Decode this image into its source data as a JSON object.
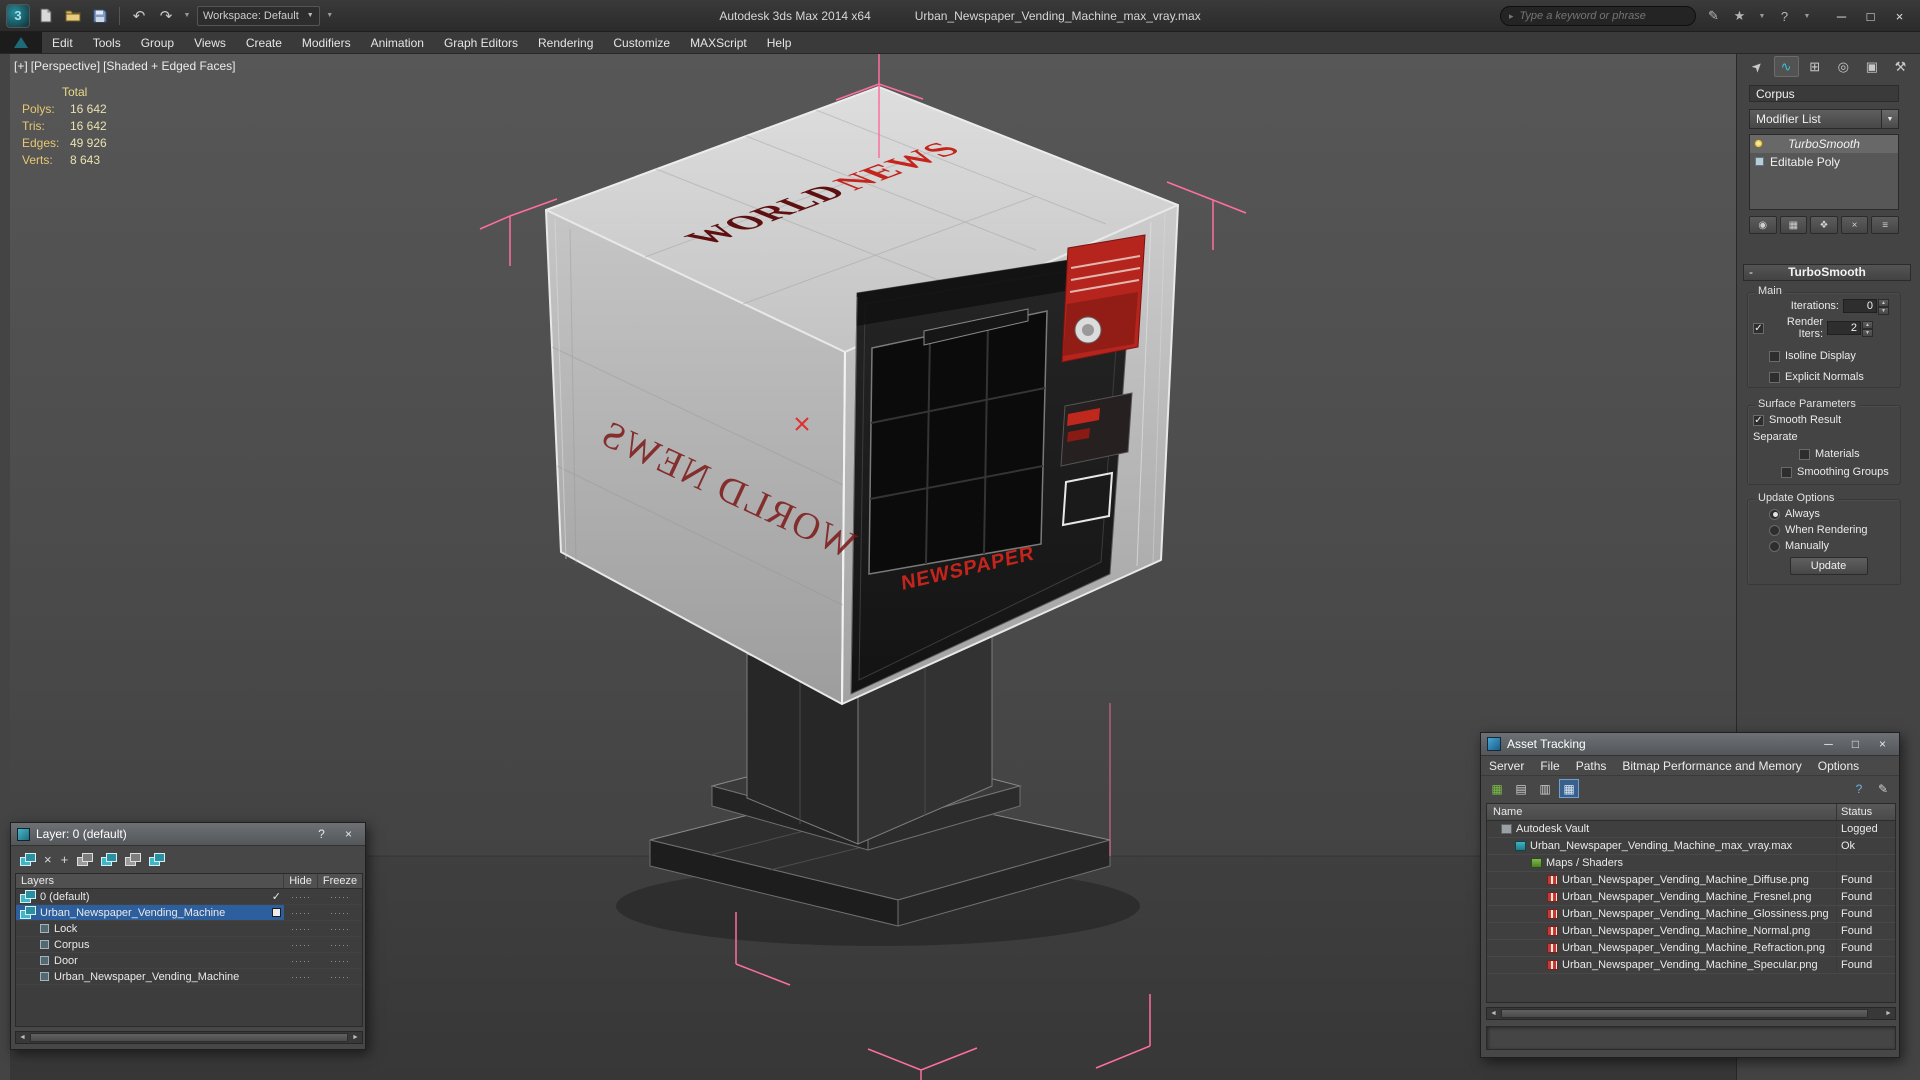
{
  "icons": {
    "dropdown": "▼",
    "check": "✓",
    "close": "×",
    "minimize": "─",
    "maximize": "□",
    "help": "?",
    "search_hint": "▸",
    "scroll_left": "◄",
    "scroll_right": "►",
    "spin_up": "▲",
    "spin_down": "▼",
    "undo": "↶",
    "redo": "↷",
    "star": "★",
    "pen": "✎",
    "plus": "+",
    "collapse": "-",
    "logo_glyph": "3",
    "tab_create": "➤",
    "tab_modify": "∿",
    "tab_hierarchy": "⊞",
    "tab_motion": "◎",
    "tab_display": "▣",
    "tab_utilities": "⚒",
    "st_pin": "◉",
    "st_show_end": "▦",
    "st_unique": "❖",
    "st_remove": "×",
    "st_configure": "≡",
    "at_refresh": "▦",
    "at_table1": "▤",
    "at_table2": "▥",
    "at_grid": "▦",
    "at_help": "?",
    "at_edit": "✎"
  },
  "titlebar": {
    "app_title": "Autodesk 3ds Max 2014 x64",
    "doc_title": "Urban_Newspaper_Vending_Machine_max_vray.max",
    "workspace": "Workspace: Default",
    "search_placeholder": "Type a keyword or phrase"
  },
  "menubar": {
    "items": [
      "Edit",
      "Tools",
      "Group",
      "Views",
      "Create",
      "Modifiers",
      "Animation",
      "Graph Editors",
      "Rendering",
      "Customize",
      "MAXScript",
      "Help"
    ]
  },
  "viewport": {
    "label_plus": "[+]",
    "label_view": "[Perspective]",
    "label_shading": "[Shaded + Edged Faces]",
    "stats": {
      "header": "Total",
      "rows": [
        {
          "label": "Polys:",
          "value": "16 642"
        },
        {
          "label": "Tris:",
          "value": "16 642"
        },
        {
          "label": "Edges:",
          "value": "49 926"
        },
        {
          "label": "Verts:",
          "value": "8 643"
        }
      ]
    },
    "model_texts": {
      "brand_word1": "WORLD",
      "brand_word2": "NEWS",
      "brand_mirrored": "WORLD NEWS",
      "door_label": "NEWSPAPER"
    }
  },
  "command_panel": {
    "object_name": "Corpus",
    "modifier_list": "Modifier List",
    "stack": {
      "modifier": "TurboSmooth",
      "base_object": "Editable Poly"
    },
    "rollout_title": "TurboSmooth",
    "group_main": "Main",
    "iterations_label": "Iterations:",
    "iterations_value": "0",
    "render_iters_label": "Render Iters:",
    "render_iters_value": "2",
    "isoline_display": "Isoline Display",
    "explicit_normals": "Explicit Normals",
    "group_surface": "Surface Parameters",
    "smooth_result": "Smooth Result",
    "separate_label": "Separate",
    "materials": "Materials",
    "smoothing_groups": "Smoothing Groups",
    "group_update": "Update Options",
    "radio_always": "Always",
    "radio_when_rendering": "When Rendering",
    "radio_manually": "Manually",
    "update_button": "Update"
  },
  "layer_window": {
    "title": "Layer: 0 (default)",
    "columns": {
      "layers": "Layers",
      "hide": "Hide",
      "freeze": "Freeze"
    },
    "dash_marks": "·····",
    "rows": [
      {
        "label": "0 (default)"
      },
      {
        "label": "Urban_Newspaper_Vending_Machine"
      },
      {
        "label": "Lock"
      },
      {
        "label": "Corpus"
      },
      {
        "label": "Door"
      },
      {
        "label": "Urban_Newspaper_Vending_Machine"
      }
    ]
  },
  "asset_t": {
    "title": "Asset Tracking",
    "menu": [
      "Server",
      "File",
      "Paths",
      "Bitmap Performance and Memory",
      "Options"
    ],
    "columns": {
      "name": "Name",
      "status": "Status"
    },
    "rows": [
      {
        "name": "Autodesk Vault",
        "status": "Logged"
      },
      {
        "name": "Urban_Newspaper_Vending_Machine_max_vray.max",
        "status": "Ok"
      },
      {
        "name": "Maps / Shaders",
        "status": ""
      },
      {
        "name": "Urban_Newspaper_Vending_Machine_Diffuse.png",
        "status": "Found"
      },
      {
        "name": "Urban_Newspaper_Vending_Machine_Fresnel.png",
        "status": "Found"
      },
      {
        "name": "Urban_Newspaper_Vending_Machine_Glossiness.png",
        "status": "Found"
      },
      {
        "name": "Urban_Newspaper_Vending_Machine_Normal.png",
        "status": "Found"
      },
      {
        "name": "Urban_Newspaper_Vending_Machine_Refraction.png",
        "status": "Found"
      },
      {
        "name": "Urban_Newspaper_Vending_Machine_Specular.png",
        "status": "Found"
      }
    ]
  },
  "colors": {
    "accent_teal": "#35c4d7",
    "selection_pink": "#ff6f9c",
    "brand_red": "#c3251c",
    "selected_row_blue": "#2d5f9e"
  }
}
